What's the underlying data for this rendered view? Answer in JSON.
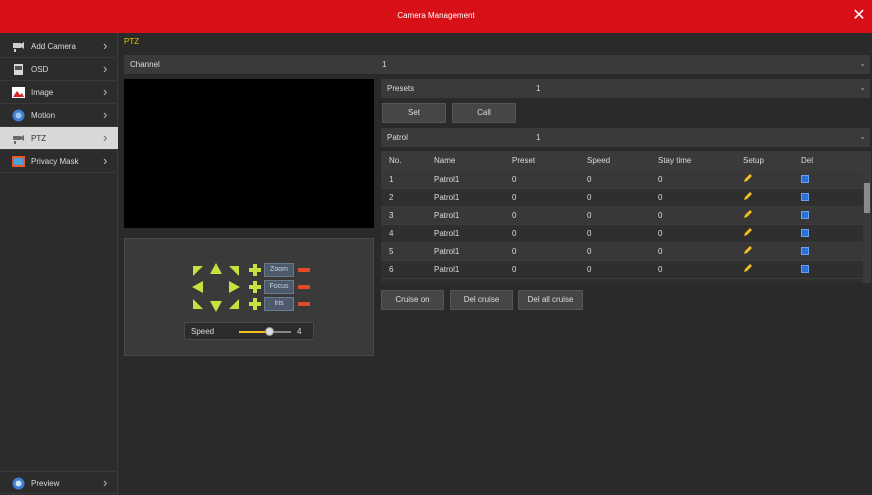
{
  "window": {
    "title": "Camera Management"
  },
  "sidebar": {
    "items": [
      {
        "label": "Add Camera",
        "icon": "add-camera-icon"
      },
      {
        "label": "OSD",
        "icon": "osd-icon"
      },
      {
        "label": "Image",
        "icon": "image-icon"
      },
      {
        "label": "Motion",
        "icon": "motion-icon"
      },
      {
        "label": "PTZ",
        "icon": "ptz-icon",
        "active": true
      },
      {
        "label": "Privacy Mask",
        "icon": "privacy-mask-icon"
      }
    ],
    "preview_label": "Preview"
  },
  "breadcrumb": "PTZ",
  "channel": {
    "label": "Channel",
    "value": "1"
  },
  "presets": {
    "label": "Presets",
    "value": "1"
  },
  "buttons": {
    "set": "Set",
    "call": "Call",
    "cruise_on": "Cruise on",
    "del_cruise": "Del cruise",
    "del_all_cruise": "Del all cruise"
  },
  "patrol": {
    "label": "Patrol",
    "value": "1"
  },
  "table": {
    "headers": [
      "No.",
      "Name",
      "Preset",
      "Speed",
      "Stay time",
      "Setup",
      "Del"
    ],
    "rows": [
      [
        "1",
        "Patrol1",
        "0",
        "0",
        "0"
      ],
      [
        "2",
        "Patrol1",
        "0",
        "0",
        "0"
      ],
      [
        "3",
        "Patrol1",
        "0",
        "0",
        "0"
      ],
      [
        "4",
        "Patrol1",
        "0",
        "0",
        "0"
      ],
      [
        "5",
        "Patrol1",
        "0",
        "0",
        "0"
      ],
      [
        "6",
        "Patrol1",
        "0",
        "0",
        "0"
      ]
    ]
  },
  "ptz_control": {
    "zoom_label": "Zoom",
    "focus_label": "Focus",
    "iris_label": "Iris",
    "speed_label": "Speed",
    "speed_value": "4"
  },
  "colors": {
    "accent_red": "#d70f16",
    "crumb_yellow": "#e2c400",
    "arrow_green": "#c8e040"
  }
}
